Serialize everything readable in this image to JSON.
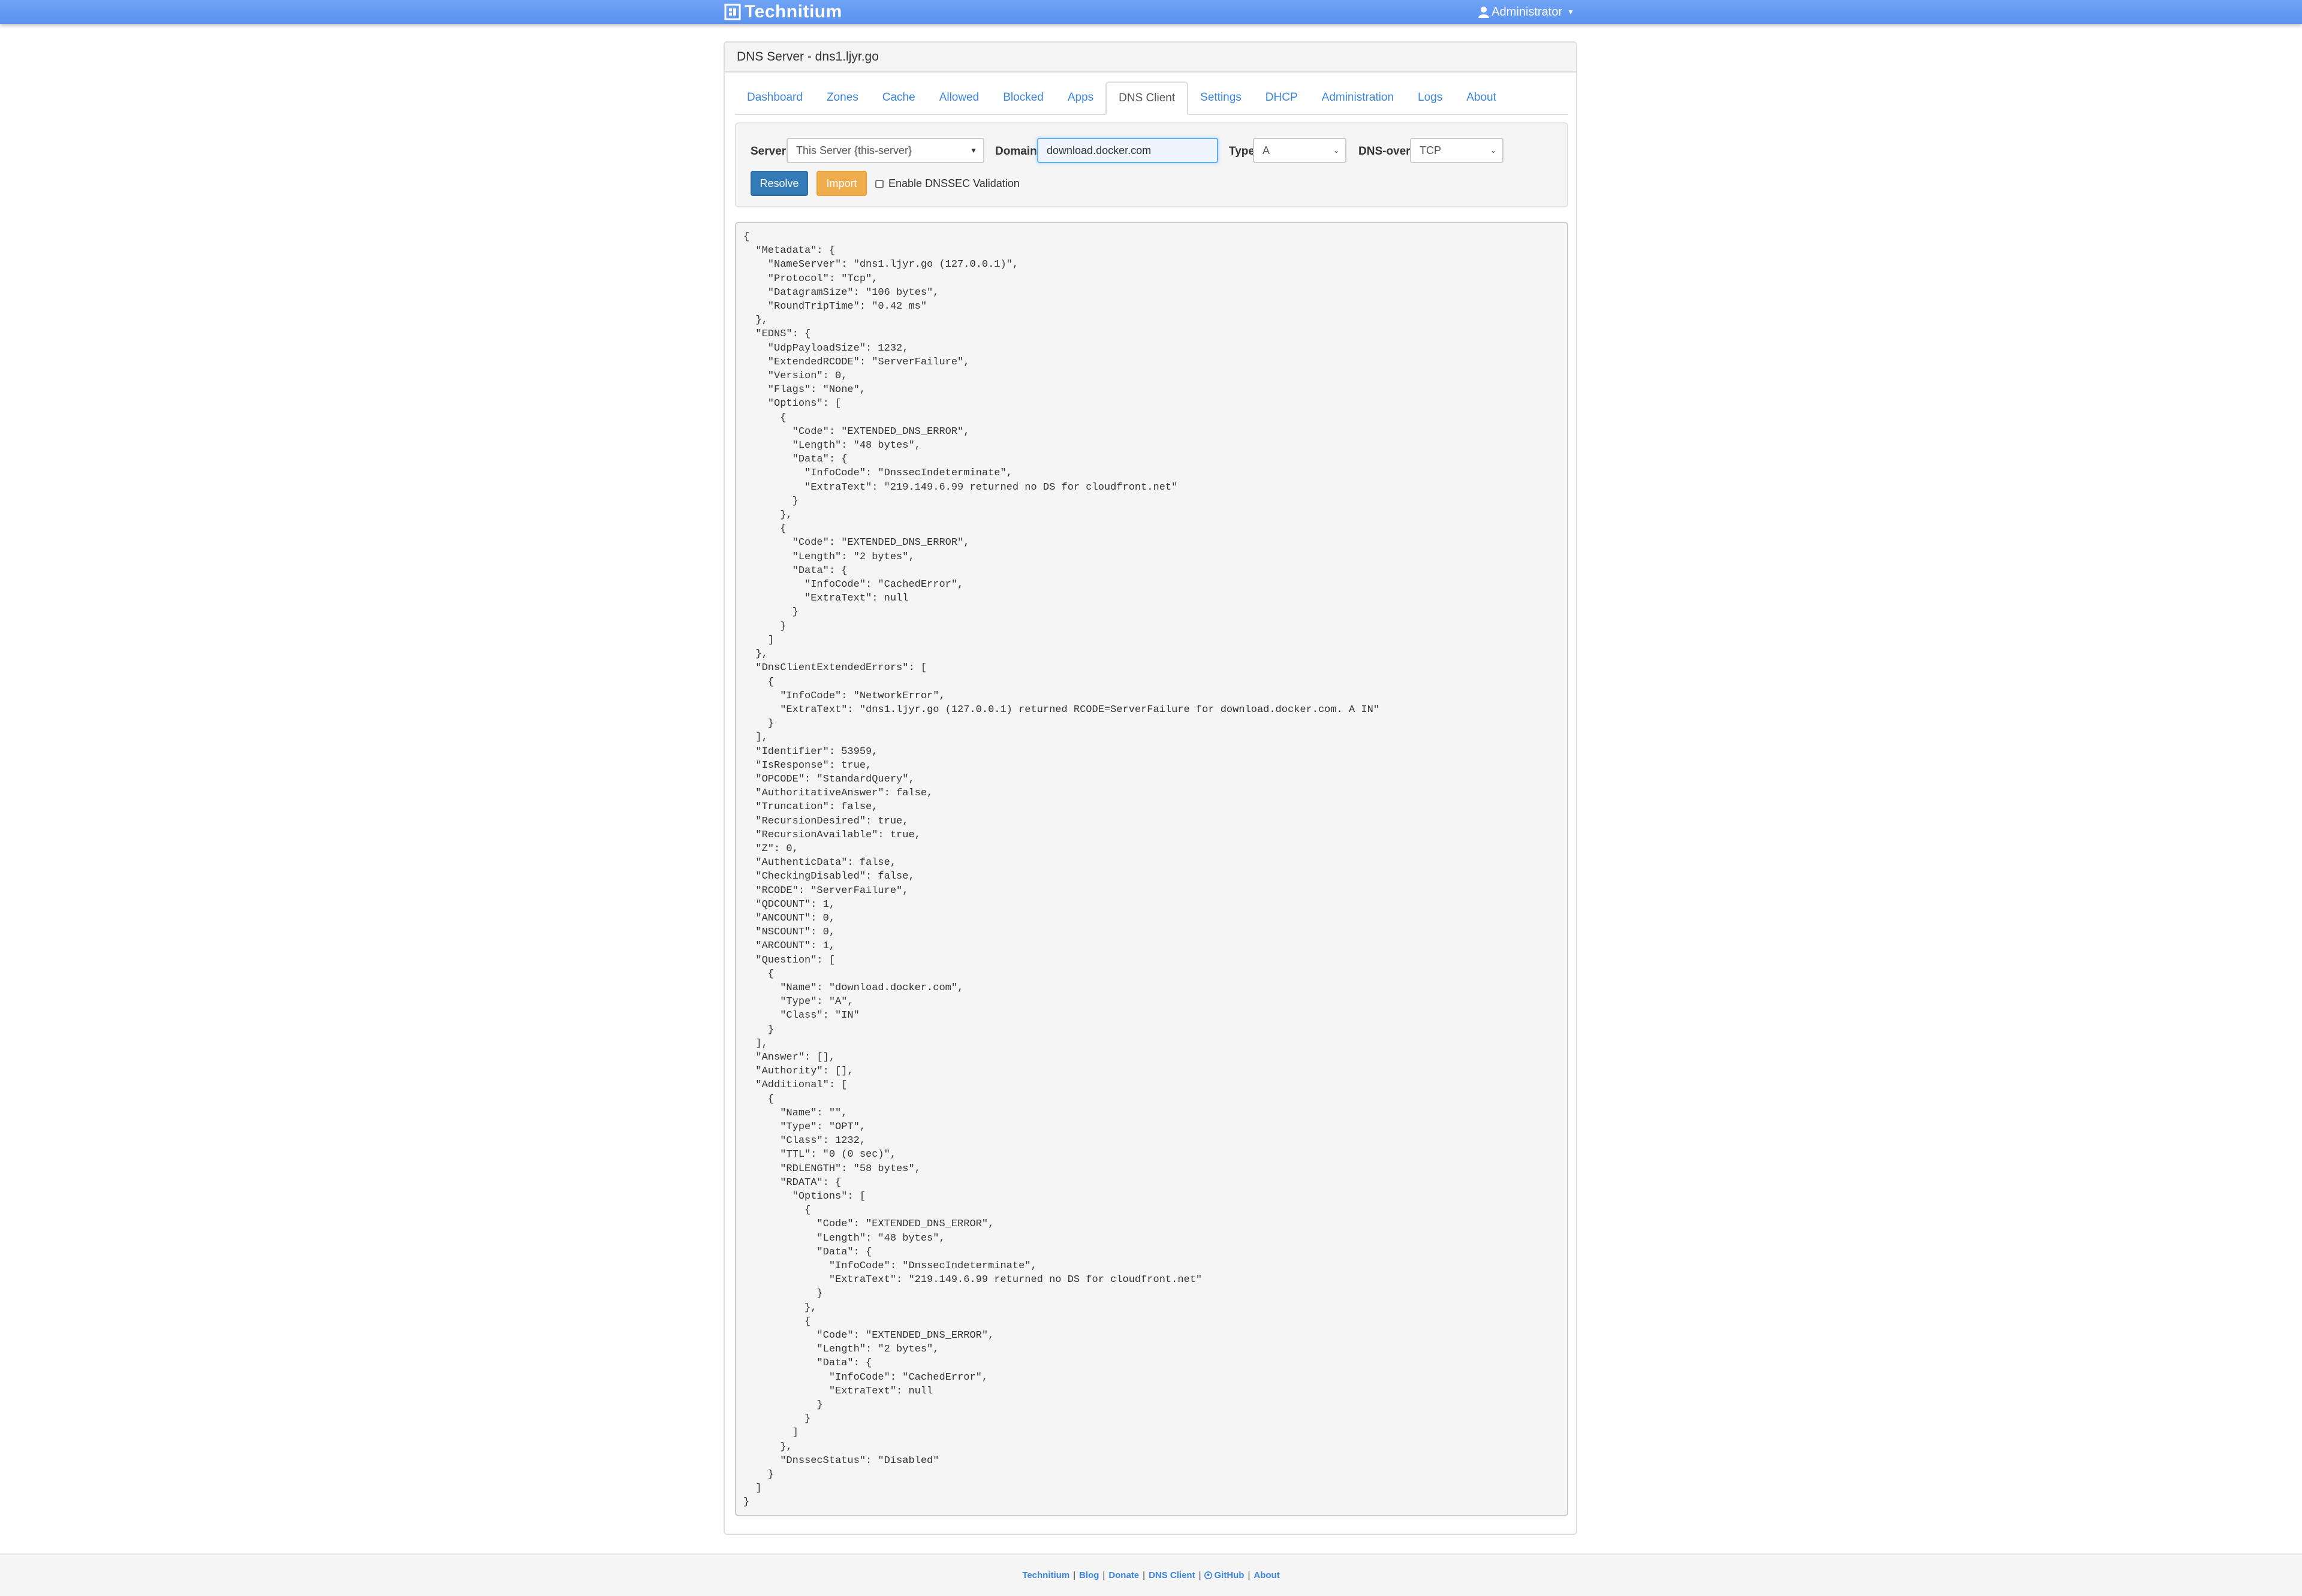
{
  "navbar": {
    "brand": "Technitium",
    "user": "Administrator"
  },
  "panel": {
    "title": "DNS Server - dns1.ljyr.go"
  },
  "tabs": [
    {
      "label": "Dashboard"
    },
    {
      "label": "Zones"
    },
    {
      "label": "Cache"
    },
    {
      "label": "Allowed"
    },
    {
      "label": "Blocked"
    },
    {
      "label": "Apps"
    },
    {
      "label": "DNS Client"
    },
    {
      "label": "Settings"
    },
    {
      "label": "DHCP"
    },
    {
      "label": "Administration"
    },
    {
      "label": "Logs"
    },
    {
      "label": "About"
    }
  ],
  "form": {
    "server_label": "Server",
    "server_value": "This Server {this-server}",
    "domain_label": "Domain",
    "domain_value": "download.docker.com",
    "type_label": "Type",
    "type_value": "A",
    "protocol_label": "DNS-over-",
    "protocol_value": "TCP",
    "resolve_label": "Resolve",
    "import_label": "Import",
    "dnssec_label": "Enable DNSSEC Validation"
  },
  "output": {
    "json_text": "{\n  \"Metadata\": {\n    \"NameServer\": \"dns1.ljyr.go (127.0.0.1)\",\n    \"Protocol\": \"Tcp\",\n    \"DatagramSize\": \"106 bytes\",\n    \"RoundTripTime\": \"0.42 ms\"\n  },\n  \"EDNS\": {\n    \"UdpPayloadSize\": 1232,\n    \"ExtendedRCODE\": \"ServerFailure\",\n    \"Version\": 0,\n    \"Flags\": \"None\",\n    \"Options\": [\n      {\n        \"Code\": \"EXTENDED_DNS_ERROR\",\n        \"Length\": \"48 bytes\",\n        \"Data\": {\n          \"InfoCode\": \"DnssecIndeterminate\",\n          \"ExtraText\": \"219.149.6.99 returned no DS for cloudfront.net\"\n        }\n      },\n      {\n        \"Code\": \"EXTENDED_DNS_ERROR\",\n        \"Length\": \"2 bytes\",\n        \"Data\": {\n          \"InfoCode\": \"CachedError\",\n          \"ExtraText\": null\n        }\n      }\n    ]\n  },\n  \"DnsClientExtendedErrors\": [\n    {\n      \"InfoCode\": \"NetworkError\",\n      \"ExtraText\": \"dns1.ljyr.go (127.0.0.1) returned RCODE=ServerFailure for download.docker.com. A IN\"\n    }\n  ],\n  \"Identifier\": 53959,\n  \"IsResponse\": true,\n  \"OPCODE\": \"StandardQuery\",\n  \"AuthoritativeAnswer\": false,\n  \"Truncation\": false,\n  \"RecursionDesired\": true,\n  \"RecursionAvailable\": true,\n  \"Z\": 0,\n  \"AuthenticData\": false,\n  \"CheckingDisabled\": false,\n  \"RCODE\": \"ServerFailure\",\n  \"QDCOUNT\": 1,\n  \"ANCOUNT\": 0,\n  \"NSCOUNT\": 0,\n  \"ARCOUNT\": 1,\n  \"Question\": [\n    {\n      \"Name\": \"download.docker.com\",\n      \"Type\": \"A\",\n      \"Class\": \"IN\"\n    }\n  ],\n  \"Answer\": [],\n  \"Authority\": [],\n  \"Additional\": [\n    {\n      \"Name\": \"\",\n      \"Type\": \"OPT\",\n      \"Class\": 1232,\n      \"TTL\": \"0 (0 sec)\",\n      \"RDLENGTH\": \"58 bytes\",\n      \"RDATA\": {\n        \"Options\": [\n          {\n            \"Code\": \"EXTENDED_DNS_ERROR\",\n            \"Length\": \"48 bytes\",\n            \"Data\": {\n              \"InfoCode\": \"DnssecIndeterminate\",\n              \"ExtraText\": \"219.149.6.99 returned no DS for cloudfront.net\"\n            }\n          },\n          {\n            \"Code\": \"EXTENDED_DNS_ERROR\",\n            \"Length\": \"2 bytes\",\n            \"Data\": {\n              \"InfoCode\": \"CachedError\",\n              \"ExtraText\": null\n            }\n          }\n        ]\n      },\n      \"DnssecStatus\": \"Disabled\"\n    }\n  ]\n}"
  },
  "footer": {
    "links": [
      "Technitium",
      "Blog",
      "Donate",
      "DNS Client",
      "GitHub",
      "About"
    ],
    "separator": "|"
  },
  "colors": {
    "navbar": "#5a92ee",
    "link": "#3a85e0",
    "primary_button": "#337ab7",
    "warning_button": "#f0ad4e"
  },
  "icons": {
    "brand": "technitium-logo-icon",
    "user": "user-icon",
    "github": "github-icon"
  }
}
